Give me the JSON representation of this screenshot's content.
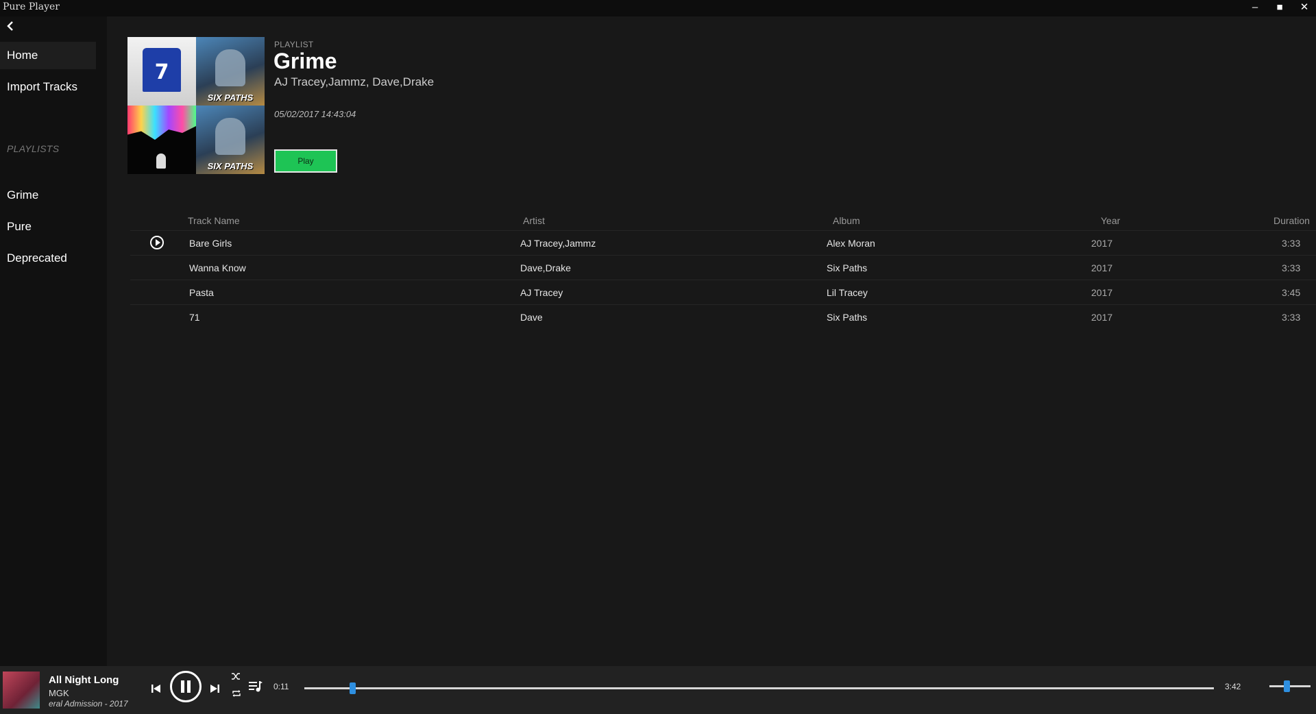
{
  "window": {
    "title": "Pure Player",
    "minimize": "–",
    "maximize": "■",
    "close": "✕"
  },
  "sidebar": {
    "back": "‹",
    "items": [
      {
        "label": "Home"
      },
      {
        "label": "Import Tracks"
      }
    ],
    "playlists_heading": "PLAYLISTS",
    "playlists": [
      {
        "label": "Grime"
      },
      {
        "label": "Pure"
      },
      {
        "label": "Deprecated"
      }
    ]
  },
  "playlist": {
    "kind": "PLAYLIST",
    "title": "Grime",
    "artists": "AJ Tracey,Jammz, Dave,Drake",
    "date": "05/02/2017 14:43:04",
    "play_label": "Play",
    "cover_text": {
      "jersey_number": "7",
      "six_paths": "SIX PATHS"
    }
  },
  "table": {
    "headers": {
      "track_name": "Track Name",
      "artist": "Artist",
      "album": "Album",
      "year": "Year",
      "duration": "Duration"
    },
    "rows": [
      {
        "name": "Bare Girls",
        "artist": "AJ Tracey,Jammz",
        "album": "Alex Moran",
        "year": "2017",
        "duration": "3:33",
        "playing": true
      },
      {
        "name": "Wanna Know",
        "artist": "Dave,Drake",
        "album": "Six Paths",
        "year": "2017",
        "duration": "3:33"
      },
      {
        "name": "Pasta",
        "artist": "AJ Tracey",
        "album": "Lil Tracey",
        "year": "2017",
        "duration": "3:45"
      },
      {
        "name": "71",
        "artist": "Dave",
        "album": "Six Paths",
        "year": "2017",
        "duration": "3:33"
      }
    ]
  },
  "now_playing": {
    "title": "All Night Long",
    "artist": "MGK",
    "album": "eral Admission - 2017",
    "current_time": "0:11",
    "total_time": "3:42",
    "progress_fraction": 0.053,
    "volume_fraction": 0.42
  },
  "colors": {
    "accent": "#1ec455",
    "slider_thumb": "#2e8fe0",
    "background": "#181818",
    "sidebar": "#111111"
  },
  "icons": {
    "back": "chevron-left-icon",
    "row_play": "play-circle-icon",
    "prev": "skip-previous-icon",
    "pause": "pause-circle-icon",
    "next": "skip-next-icon",
    "shuffle": "shuffle-icon",
    "repeat": "repeat-icon",
    "queue": "queue-icon"
  }
}
